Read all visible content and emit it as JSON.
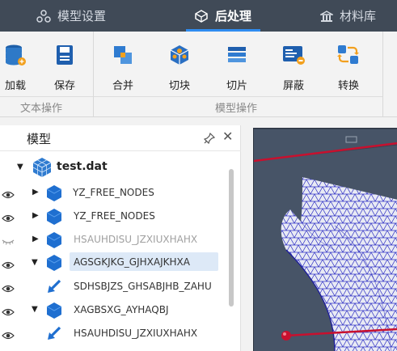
{
  "tabs": [
    {
      "label": "模型设置",
      "icon": "model-settings-icon",
      "active": false
    },
    {
      "label": "后处理",
      "icon": "post-processing-icon",
      "active": true
    },
    {
      "label": "材料库",
      "icon": "material-library-icon",
      "active": false
    }
  ],
  "ribbon": {
    "groups": [
      {
        "label": "文本操作"
      },
      {
        "label": "模型操作"
      }
    ],
    "buttons": [
      {
        "label": "加载",
        "icon": "database-load-icon"
      },
      {
        "label": "保存",
        "icon": "save-icon"
      },
      {
        "label": "合并",
        "icon": "merge-icon"
      },
      {
        "label": "切块",
        "icon": "cut-block-icon"
      },
      {
        "label": "切片",
        "icon": "slice-icon"
      },
      {
        "label": "屏蔽",
        "icon": "mask-icon"
      },
      {
        "label": "转换",
        "icon": "convert-icon"
      }
    ]
  },
  "panel": {
    "title": "模型",
    "pin_icon": "pin-icon",
    "close_icon": "close-icon"
  },
  "tree": {
    "root": {
      "label": "test.dat",
      "icon": "mesh-cube-icon",
      "expanded": true
    },
    "items": [
      {
        "label": "YZ_FREE_NODES",
        "visible": true,
        "expander": "collapsed",
        "icon": "blue-cube-icon",
        "dimmed": false,
        "selected": false
      },
      {
        "label": "YZ_FREE_NODES",
        "visible": true,
        "expander": "collapsed",
        "icon": "blue-cube-icon",
        "dimmed": false,
        "selected": false
      },
      {
        "label": "HSAUHDISU_JZXIUXHAHX",
        "visible": false,
        "expander": "collapsed",
        "icon": "blue-cube-icon",
        "dimmed": true,
        "selected": false
      },
      {
        "label": "AGSGKJKG_GJHXAJKHXA",
        "visible": true,
        "expander": "expanded",
        "icon": "blue-cube-icon",
        "dimmed": false,
        "selected": true
      },
      {
        "label": "SDHSBJZS_GHSABJHB_ZAHU",
        "visible": true,
        "expander": "none",
        "icon": "blue-arrow-icon",
        "dimmed": false,
        "selected": false
      },
      {
        "label": "XAGBSXG_AYHAQBJ",
        "visible": true,
        "expander": "expanded",
        "icon": "blue-cube-icon",
        "dimmed": false,
        "selected": false
      },
      {
        "label": "HSAUHDISU_JZXIUXHAHX",
        "visible": true,
        "expander": "none",
        "icon": "blue-arrow-icon",
        "dimmed": false,
        "selected": false
      }
    ]
  },
  "colors": {
    "topbar": "#404a57",
    "accent": "#2f8cf0",
    "selection": "#dde9f7",
    "viewport_bg": "#475467",
    "mesh": "#2e2fc4",
    "axis_red": "#c8102e"
  }
}
